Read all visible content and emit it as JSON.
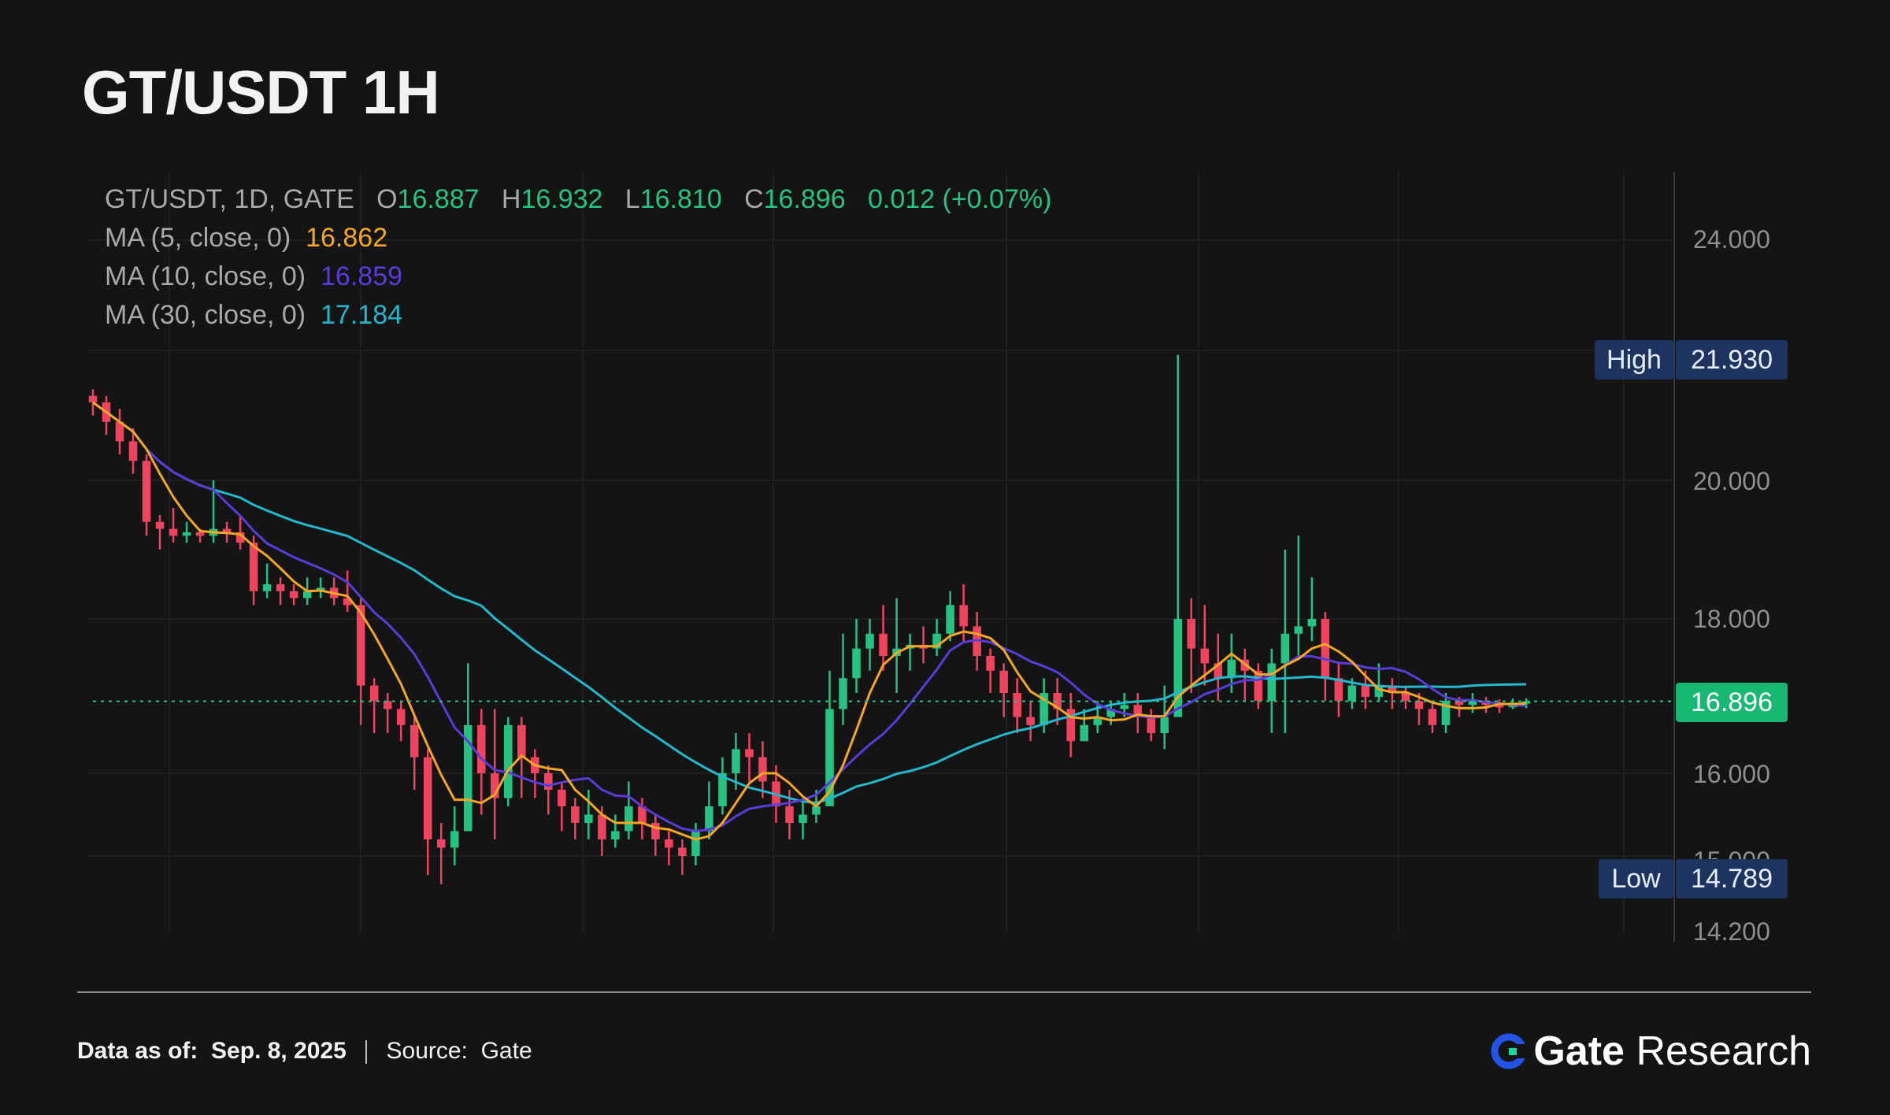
{
  "title": "GT/USDT 1H",
  "legend": {
    "symbol": "GT/USDT, 1D, GATE",
    "o_label": "O",
    "o": "16.887",
    "h_label": "H",
    "h": "16.932",
    "l_label": "L",
    "l": "16.810",
    "c_label": "C",
    "c": "16.896",
    "change": "0.012 (+0.07%)",
    "ma5_label": "MA (5, close, 0)",
    "ma5": "16.862",
    "ma10_label": "MA (10, close, 0)",
    "ma10": "16.859",
    "ma30_label": "MA (30, close, 0)",
    "ma30": "17.184"
  },
  "tags": {
    "high_label": "High",
    "high": "21.930",
    "low_label": "Low",
    "low": "14.789",
    "current": "16.896"
  },
  "footer": {
    "data_label": "Data as of:",
    "date": "Sep. 8, 2025",
    "source_label": "Source:",
    "source": "Gate",
    "brand_gate": "Gate",
    "brand_research": "Research"
  },
  "colors": {
    "up": "#26c281",
    "down": "#f0435e",
    "ma5": "#f5a623",
    "ma10": "#5b3bd9",
    "ma30": "#22b8cf",
    "background": "#141414",
    "tag_bg": "#1d3461",
    "current_tag_bg": "#16b872"
  },
  "chart_data": {
    "type": "candlestick",
    "title": "GT/USDT 1H",
    "y_ticks": [
      "24.000",
      "20.000",
      "18.000",
      "16.000",
      "15.000",
      "14.200"
    ],
    "high": 21.93,
    "low": 14.789,
    "current": 16.896,
    "candles": [
      [
        21.3,
        21.2,
        21.4,
        21.0
      ],
      [
        21.2,
        20.9,
        21.3,
        20.7
      ],
      [
        20.9,
        20.6,
        21.1,
        20.4
      ],
      [
        20.6,
        20.3,
        20.8,
        20.1
      ],
      [
        20.3,
        19.4,
        20.4,
        19.2
      ],
      [
        19.4,
        19.3,
        19.5,
        19.0
      ],
      [
        19.3,
        19.2,
        19.6,
        19.1
      ],
      [
        19.2,
        19.25,
        19.4,
        19.1
      ],
      [
        19.25,
        19.2,
        19.3,
        19.1
      ],
      [
        19.2,
        19.3,
        20.0,
        19.1
      ],
      [
        19.3,
        19.25,
        19.4,
        19.1
      ],
      [
        19.25,
        19.1,
        19.5,
        19.0
      ],
      [
        19.1,
        18.4,
        19.2,
        18.2
      ],
      [
        18.4,
        18.5,
        18.8,
        18.3
      ],
      [
        18.5,
        18.4,
        18.6,
        18.2
      ],
      [
        18.4,
        18.3,
        18.5,
        18.2
      ],
      [
        18.3,
        18.4,
        18.6,
        18.2
      ],
      [
        18.4,
        18.45,
        18.6,
        18.3
      ],
      [
        18.45,
        18.3,
        18.6,
        18.2
      ],
      [
        18.3,
        18.2,
        18.7,
        18.1
      ],
      [
        18.2,
        17.1,
        18.3,
        16.6
      ],
      [
        17.1,
        16.9,
        17.2,
        16.5
      ],
      [
        16.9,
        16.8,
        17.0,
        16.5
      ],
      [
        16.8,
        16.6,
        16.9,
        16.4
      ],
      [
        16.6,
        16.2,
        16.7,
        15.8
      ],
      [
        16.2,
        15.2,
        16.3,
        14.8
      ],
      [
        15.2,
        15.1,
        15.4,
        14.7
      ],
      [
        15.1,
        15.3,
        15.6,
        14.9
      ],
      [
        15.3,
        16.6,
        17.4,
        15.3
      ],
      [
        16.6,
        16.0,
        16.8,
        15.5
      ],
      [
        16.0,
        15.7,
        16.8,
        15.2
      ],
      [
        15.7,
        16.6,
        16.7,
        15.6
      ],
      [
        16.6,
        16.2,
        16.7,
        15.7
      ],
      [
        16.2,
        16.0,
        16.3,
        15.7
      ],
      [
        16.0,
        15.8,
        16.1,
        15.5
      ],
      [
        15.8,
        15.6,
        15.9,
        15.3
      ],
      [
        15.6,
        15.4,
        15.7,
        15.2
      ],
      [
        15.4,
        15.5,
        15.8,
        15.2
      ],
      [
        15.5,
        15.2,
        15.6,
        15.0
      ],
      [
        15.2,
        15.3,
        15.5,
        15.1
      ],
      [
        15.3,
        15.6,
        15.9,
        15.2
      ],
      [
        15.6,
        15.4,
        15.7,
        15.2
      ],
      [
        15.4,
        15.2,
        15.5,
        15.0
      ],
      [
        15.2,
        15.1,
        15.3,
        14.9
      ],
      [
        15.1,
        15.0,
        15.2,
        14.8
      ],
      [
        15.0,
        15.3,
        15.4,
        14.9
      ],
      [
        15.3,
        15.6,
        15.9,
        15.2
      ],
      [
        15.6,
        16.0,
        16.2,
        15.5
      ],
      [
        16.0,
        16.3,
        16.5,
        15.8
      ],
      [
        16.3,
        16.2,
        16.5,
        15.9
      ],
      [
        16.2,
        15.9,
        16.4,
        15.7
      ],
      [
        15.9,
        15.6,
        16.1,
        15.4
      ],
      [
        15.6,
        15.4,
        15.8,
        15.2
      ],
      [
        15.4,
        15.5,
        15.7,
        15.2
      ],
      [
        15.5,
        15.6,
        15.8,
        15.4
      ],
      [
        15.6,
        16.8,
        17.3,
        15.8
      ],
      [
        16.8,
        17.2,
        17.8,
        16.6
      ],
      [
        17.2,
        17.6,
        18.0,
        17.0
      ],
      [
        17.6,
        17.8,
        18.0,
        17.3
      ],
      [
        17.8,
        17.5,
        18.2,
        17.3
      ],
      [
        17.5,
        17.6,
        18.3,
        17.0
      ],
      [
        17.6,
        17.65,
        17.8,
        17.3
      ],
      [
        17.65,
        17.6,
        17.9,
        17.4
      ],
      [
        17.6,
        17.8,
        18.0,
        17.5
      ],
      [
        17.8,
        18.2,
        18.4,
        17.7
      ],
      [
        18.2,
        17.9,
        18.5,
        17.7
      ],
      [
        17.9,
        17.5,
        18.1,
        17.3
      ],
      [
        17.5,
        17.3,
        17.6,
        17.0
      ],
      [
        17.3,
        17.0,
        17.4,
        16.7
      ],
      [
        17.0,
        16.7,
        17.2,
        16.5
      ],
      [
        16.7,
        16.6,
        16.9,
        16.4
      ],
      [
        16.6,
        17.0,
        17.2,
        16.5
      ],
      [
        17.0,
        16.8,
        17.2,
        16.6
      ],
      [
        16.8,
        16.4,
        17.0,
        16.2
      ],
      [
        16.4,
        16.6,
        16.8,
        16.4
      ],
      [
        16.6,
        16.7,
        16.9,
        16.5
      ],
      [
        16.7,
        16.8,
        16.9,
        16.6
      ],
      [
        16.8,
        16.85,
        17.0,
        16.7
      ],
      [
        16.85,
        16.7,
        17.0,
        16.5
      ],
      [
        16.7,
        16.5,
        16.8,
        16.4
      ],
      [
        16.5,
        16.7,
        17.1,
        16.3
      ],
      [
        16.7,
        18.0,
        21.93,
        16.9
      ],
      [
        18.0,
        17.6,
        18.3,
        17.0
      ],
      [
        17.6,
        17.4,
        18.2,
        17.1
      ],
      [
        17.4,
        17.2,
        17.8,
        16.9
      ],
      [
        17.2,
        17.45,
        17.8,
        17.0
      ],
      [
        17.45,
        17.3,
        17.6,
        16.9
      ],
      [
        17.3,
        16.9,
        17.4,
        16.8
      ],
      [
        16.9,
        17.4,
        17.6,
        16.5
      ],
      [
        17.4,
        17.8,
        19.0,
        16.5
      ],
      [
        17.8,
        17.9,
        19.2,
        17.5
      ],
      [
        17.9,
        18.0,
        18.6,
        17.7
      ],
      [
        18.0,
        17.2,
        18.1,
        16.9
      ],
      [
        17.2,
        16.9,
        17.4,
        16.7
      ],
      [
        16.9,
        17.1,
        17.2,
        16.8
      ],
      [
        17.1,
        16.95,
        17.3,
        16.8
      ],
      [
        16.95,
        17.1,
        17.4,
        16.9
      ],
      [
        17.1,
        17.0,
        17.2,
        16.8
      ],
      [
        17.0,
        16.9,
        17.1,
        16.8
      ],
      [
        16.9,
        16.8,
        17.0,
        16.6
      ],
      [
        16.8,
        16.6,
        16.9,
        16.5
      ],
      [
        16.6,
        16.9,
        17.0,
        16.5
      ],
      [
        16.9,
        16.85,
        16.95,
        16.7
      ],
      [
        16.85,
        16.9,
        17.0,
        16.75
      ],
      [
        16.9,
        16.85,
        16.95,
        16.75
      ],
      [
        16.85,
        16.82,
        16.92,
        16.75
      ],
      [
        16.82,
        16.88,
        16.93,
        16.8
      ],
      [
        16.887,
        16.896,
        16.932,
        16.81
      ]
    ]
  }
}
